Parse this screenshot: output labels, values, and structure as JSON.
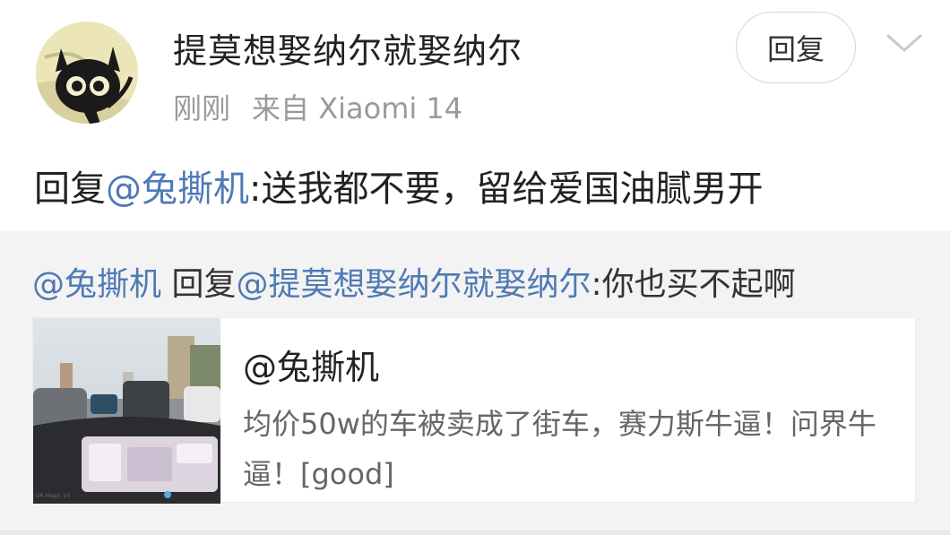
{
  "post": {
    "username": "提莫想娶纳尔就娶纳尔",
    "time": "刚刚",
    "source": "来自 Xiaomi 14",
    "reply_button": "回复",
    "avatar_icon": "black-cat-avatar-icon",
    "menu_icon": "chevron-down-icon",
    "content_prefix": "回复",
    "content_mention": "@兔撕机",
    "content_text": ":送我都不要，留给爱国油腻男开"
  },
  "quote": {
    "mention1": "@兔撕机",
    "reply_word": " 回复",
    "mention2": "@提莫想娶纳尔就娶纳尔",
    "text": ":你也买不起啊",
    "card": {
      "title": "@兔撕机",
      "desc": "均价50w的车被卖成了街车，赛力斯牛逼！问界牛逼！[good]",
      "thumb_caption": "DR Magic V3"
    }
  },
  "colors": {
    "mention": "#4f7ab4",
    "meta": "#9a9a9a",
    "quote_bg": "#f3f3f3"
  }
}
